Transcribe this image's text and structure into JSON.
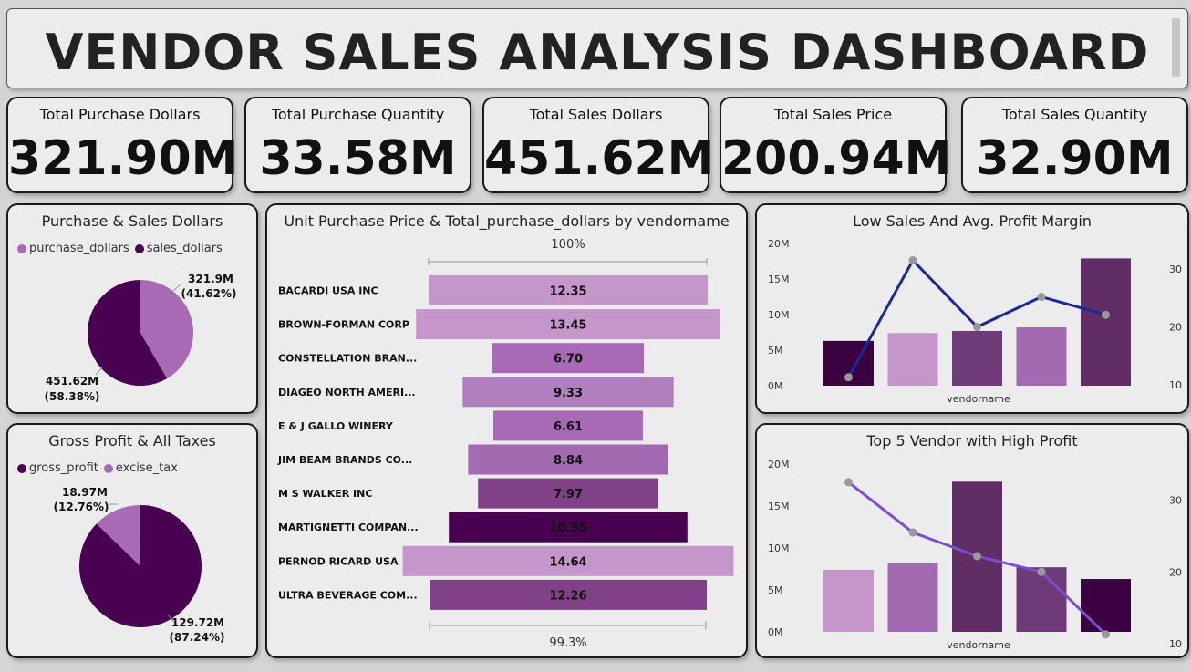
{
  "title": "VENDOR SALES ANALYSIS DASHBOARD",
  "kpis": [
    {
      "label": "Total Purchase Dollars",
      "value": "321.90M"
    },
    {
      "label": "Total Purchase Quantity",
      "value": "33.58M"
    },
    {
      "label": "Total Sales Dollars",
      "value": "451.62M"
    },
    {
      "label": "Total Sales Price",
      "value": "200.94M"
    },
    {
      "label": "Total Sales Quantity",
      "value": "32.90M"
    }
  ],
  "colors": {
    "light_purple": "#c596ca",
    "mid_purple": "#a26ab0",
    "purple": "#814189",
    "deep_purple": "#5c2a6b",
    "dark_purple": "#4a0050",
    "blue_line": "#1a2a99",
    "violet_line": "#7a4ecf"
  },
  "chart_data": [
    {
      "type": "pie",
      "title": "Purchase & Sales Dollars",
      "legend": [
        "purchase_dollars",
        "sales_dollars"
      ],
      "values": [
        321.9,
        451.62
      ],
      "colors": [
        "#a86ab5",
        "#4a0050"
      ],
      "labels": [
        "321.9M",
        "451.62M"
      ],
      "percents": [
        "(41.62%)",
        "(58.38%)"
      ]
    },
    {
      "type": "pie",
      "title": "Gross Profit & All Taxes",
      "legend": [
        "gross_profit",
        "excise_tax"
      ],
      "values": [
        129.72,
        18.97
      ],
      "colors": [
        "#4a0050",
        "#a86ab5"
      ],
      "labels": [
        "129.72M",
        "18.97M"
      ],
      "percents": [
        "(87.24%)",
        "(12.76%)"
      ]
    },
    {
      "type": "bar",
      "title": "Unit Purchase Price & Total_purchase_dollars by vendorname",
      "top_label": "100%",
      "bottom_label": "99.3%",
      "categories": [
        "BACARDI USA INC",
        "BROWN-FORMAN CORP",
        "CONSTELLATION BRAN...",
        "DIAGEO NORTH AMERI...",
        "E & J GALLO WINERY",
        "JIM BEAM BRANDS CO...",
        "M S WALKER INC",
        "MARTIGNETTI COMPAN...",
        "PERNOD RICARD USA",
        "ULTRA BEVERAGE COM..."
      ],
      "values": [
        12.35,
        13.45,
        6.7,
        9.33,
        6.61,
        8.84,
        7.97,
        10.55,
        14.64,
        12.26
      ],
      "value_labels": [
        "12.35",
        "13.45",
        "6.70",
        "9.33",
        "6.61",
        "8.84",
        "7.97",
        "10.55",
        "14.64",
        "12.26"
      ],
      "colors": [
        "#c596ca",
        "#c596ca",
        "#a86ab5",
        "#b07fbd",
        "#a86ab5",
        "#a26ab0",
        "#814189",
        "#4a0050",
        "#c596ca",
        "#814189"
      ]
    },
    {
      "type": "bar",
      "title": "Low Sales And Avg. Profit Margin",
      "xlabel": "vendorname",
      "y_ticks": [
        "0M",
        "5M",
        "10M",
        "15M",
        "20M"
      ],
      "ylim": [
        0,
        20
      ],
      "y2_ticks": [
        "10",
        "20",
        "30"
      ],
      "y2lim": [
        10,
        33
      ],
      "bar_values": [
        6.3,
        7.4,
        7.7,
        8.2,
        17.9
      ],
      "line_values": [
        11.3,
        31.5,
        20.0,
        25.2,
        22.1
      ],
      "colors": [
        "#3a0040",
        "#c596ca",
        "#6e3b78",
        "#a26ab0",
        "#602d64"
      ],
      "line_color": "#1a2a99"
    },
    {
      "type": "bar",
      "title": "Top 5 Vendor with High Profit",
      "xlabel": "vendorname",
      "y_ticks": [
        "0M",
        "5M",
        "10M",
        "15M",
        "20M"
      ],
      "ylim": [
        0,
        20
      ],
      "y2_ticks": [
        "10",
        "20",
        "30"
      ],
      "y2lim": [
        10,
        33
      ],
      "bar_values": [
        7.4,
        8.2,
        17.9,
        7.7,
        6.3
      ],
      "line_values": [
        32.5,
        25.5,
        22.2,
        20.0,
        11.3
      ],
      "colors": [
        "#c596ca",
        "#a26ab0",
        "#602d64",
        "#6e3b78",
        "#3a0040"
      ],
      "line_color": "#7a4ecf"
    }
  ]
}
